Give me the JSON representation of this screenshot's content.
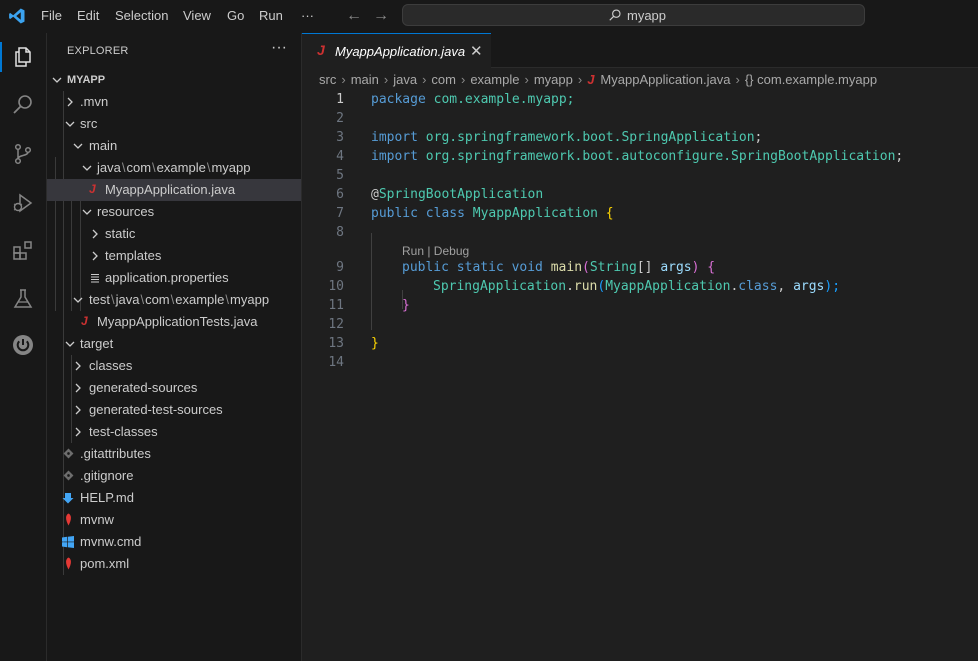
{
  "titlebar": {
    "menu": [
      "File",
      "Edit",
      "Selection",
      "View",
      "Go",
      "Run",
      "···"
    ],
    "search_text": "myapp"
  },
  "explorer": {
    "title": "EXPLORER",
    "more": "···",
    "root": "MYAPP",
    "rows": [
      {
        "label": ".mvn"
      },
      {
        "label": "src"
      },
      {
        "label": "main"
      },
      {
        "parts": [
          "java",
          "com",
          "example",
          "myapp"
        ]
      },
      {
        "label": "MyappApplication.java",
        "icon": "J"
      },
      {
        "label": "resources"
      },
      {
        "label": "static"
      },
      {
        "label": "templates"
      },
      {
        "label": "application.properties"
      },
      {
        "parts": [
          "test",
          "java",
          "com",
          "example",
          "myapp"
        ]
      },
      {
        "label": "MyappApplicationTests.java",
        "icon": "J"
      },
      {
        "label": "target"
      },
      {
        "label": "classes"
      },
      {
        "label": "generated-sources"
      },
      {
        "label": "generated-test-sources"
      },
      {
        "label": "test-classes"
      },
      {
        "label": ".gitattributes"
      },
      {
        "label": ".gitignore"
      },
      {
        "label": "HELP.md"
      },
      {
        "label": "mvnw"
      },
      {
        "label": "mvnw.cmd"
      },
      {
        "label": "pom.xml"
      }
    ]
  },
  "editor": {
    "tab": {
      "icon": "J",
      "title": "MyappApplication.java",
      "close": "✕"
    },
    "breadcrumb": [
      "src",
      "main",
      "java",
      "com",
      "example",
      "myapp"
    ],
    "breadcrumb_file": "MyappApplication.java",
    "breadcrumb_symbol": "{} com.example.myapp",
    "line_numbers": [
      "1",
      "2",
      "3",
      "4",
      "5",
      "6",
      "7",
      "8",
      "9",
      "10",
      "11",
      "12",
      "13",
      "14"
    ],
    "codelens": "Run | Debug",
    "code": {
      "l1_kw": "package",
      "l1_rest": " com.example.myapp;",
      "l3_kw": "import",
      "l3_pkg": " org.springframework.boot.",
      "l3_cls": "SpringApplication",
      "l3_end": ";",
      "l4_kw": "import",
      "l4_pkg": " org.springframework.boot.autoconfigure.",
      "l4_cls": "SpringBootApplication",
      "l4_end": ";",
      "l6_at": "@",
      "l6_ann": "SpringBootApplication",
      "l7_kw": "public class ",
      "l7_cls": "MyappApplication",
      "l7_br": " {",
      "l9_kw": "public static void ",
      "l9_fn": "main",
      "l9_p1": "(",
      "l9_ty": "String",
      "l9_arr": "[] ",
      "l9_var": "args",
      "l9_p2": ")",
      "l9_br": " {",
      "l10_cls": "SpringApplication",
      "l10_dot": ".",
      "l10_fn": "run",
      "l10_p1": "(",
      "l10_arg": "MyappApplication",
      "l10_dot2": ".",
      "l10_kw": "class",
      "l10_comma": ", ",
      "l10_var": "args",
      "l10_p2": ");",
      "l11_br": "}",
      "l13_br": "}"
    }
  }
}
